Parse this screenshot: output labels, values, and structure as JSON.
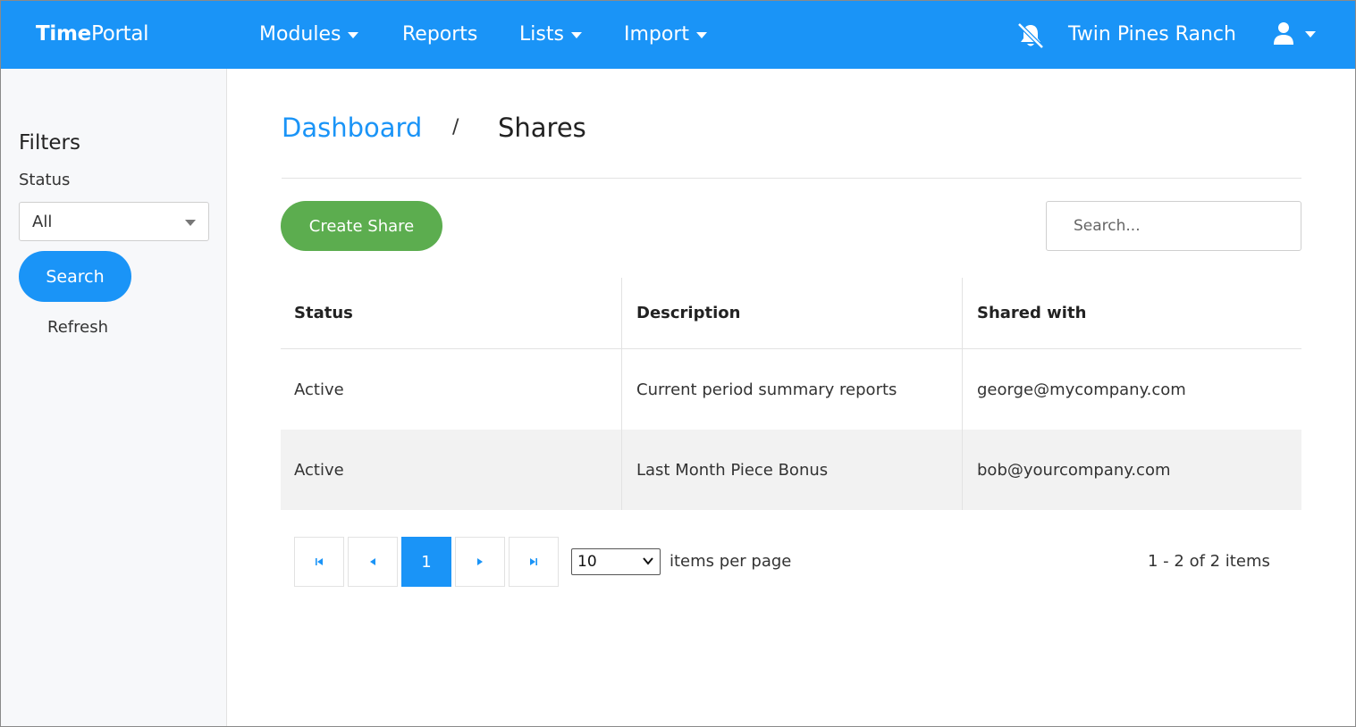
{
  "app": {
    "brand_bold": "Time",
    "brand_rest": "Portal"
  },
  "nav": {
    "modules": "Modules",
    "reports": "Reports",
    "lists": "Lists",
    "import": "Import",
    "company": "Twin Pines Ranch"
  },
  "sidebar": {
    "title": "Filters",
    "status_label": "Status",
    "status_value": "All",
    "search_label": "Search",
    "refresh_label": "Refresh"
  },
  "breadcrumb": {
    "parent": "Dashboard",
    "separator": "/",
    "current": "Shares"
  },
  "toolbar": {
    "create_label": "Create Share",
    "search_placeholder": "Search..."
  },
  "table": {
    "headers": [
      "Status",
      "Description",
      "Shared with"
    ],
    "rows": [
      [
        "Active",
        "Current period summary reports",
        "george@mycompany.com"
      ],
      [
        "Active",
        "Last Month Piece Bonus",
        "bob@yourcompany.com"
      ]
    ]
  },
  "pager": {
    "current_page": "1",
    "page_size": "10",
    "page_size_label": "items per page",
    "summary": "1 - 2 of 2 items"
  },
  "colors": {
    "primary": "#1a94f7",
    "create": "#5cad4f"
  }
}
